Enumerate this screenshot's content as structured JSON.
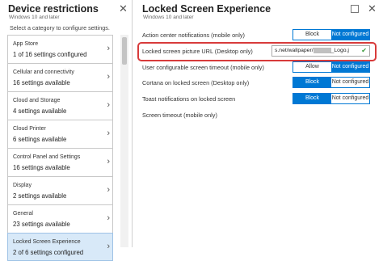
{
  "left": {
    "title": "Device restrictions",
    "subtitle": "Windows 10 and later",
    "instruction": "Select a category to configure settings.",
    "categories": [
      {
        "name": "App Store",
        "count": "1 of 16 settings configured"
      },
      {
        "name": "Cellular and connectivity",
        "count": "16 settings available"
      },
      {
        "name": "Cloud and Storage",
        "count": "4 settings available"
      },
      {
        "name": "Cloud Printer",
        "count": "6 settings available"
      },
      {
        "name": "Control Panel and Settings",
        "count": "16 settings available"
      },
      {
        "name": "Display",
        "count": "2 settings available"
      },
      {
        "name": "General",
        "count": "23 settings available"
      },
      {
        "name": "Locked Screen Experience",
        "count": "2 of 6 settings configured"
      }
    ]
  },
  "right": {
    "title": "Locked Screen Experience",
    "subtitle": "Windows 10 and later",
    "settings": [
      {
        "label": "Action center notifications (mobile only)",
        "left": "Block",
        "right": "Not configured"
      },
      {
        "label": "Locked screen picture URL (Desktop only)",
        "value_pre": "s.net/wallpaper/",
        "value_post": "_Logo.j"
      },
      {
        "label": "User configurable screen timeout (mobile only)",
        "left": "Allow",
        "right": "Not configured"
      },
      {
        "label": "Cortana on locked screen (Desktop only)",
        "left": "Block",
        "right": "Not configured"
      },
      {
        "label": "Toast notifications on locked screen",
        "left": "Block",
        "right": "Not configured"
      },
      {
        "label": "Screen timeout (mobile only)"
      }
    ]
  },
  "colors": {
    "accent": "#0078d4",
    "selected_bg": "#d8e9f8",
    "highlight": "#d83b3b",
    "valid": "#3c9b3c"
  },
  "icons": {
    "close": "close-icon",
    "chevron": "chevron-right-icon",
    "check": "check-icon",
    "maximize": "maximize-icon"
  }
}
